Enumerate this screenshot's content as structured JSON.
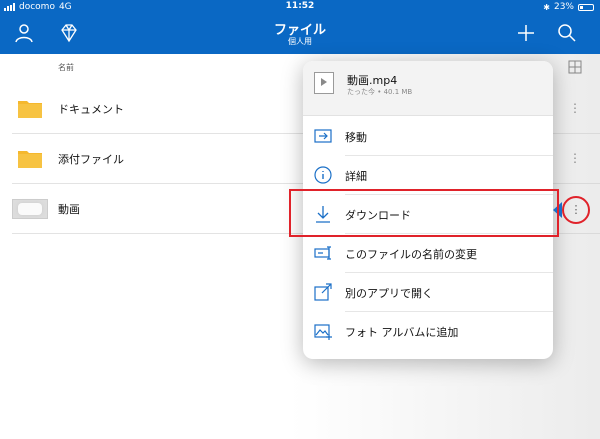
{
  "status_bar": {
    "carrier": "docomo",
    "network": "4G",
    "time": "11:52",
    "battery": "23%",
    "battery_level": 0.23
  },
  "header": {
    "title": "ファイル",
    "subtitle": "個人用"
  },
  "list": {
    "column_name": "名前",
    "items": [
      {
        "label": "ドキュメント",
        "type": "folder"
      },
      {
        "label": "添付ファイル",
        "type": "folder"
      },
      {
        "label": "動画",
        "type": "video"
      }
    ]
  },
  "popup": {
    "file_name": "動画.mp4",
    "file_meta": "たった今 • 40.1 MB",
    "menu": [
      {
        "label": "移動",
        "icon": "move-icon"
      },
      {
        "label": "詳細",
        "icon": "info-icon"
      },
      {
        "label": "ダウンロード",
        "icon": "download-icon"
      },
      {
        "label": "このファイルの名前の変更",
        "icon": "rename-icon"
      },
      {
        "label": "別のアプリで開く",
        "icon": "open-in-icon"
      },
      {
        "label": "フォト アルバムに追加",
        "icon": "photo-album-icon"
      }
    ]
  },
  "colors": {
    "accent": "#0a68c4",
    "folder": "#f5b82e",
    "highlight": "#e0222a"
  }
}
